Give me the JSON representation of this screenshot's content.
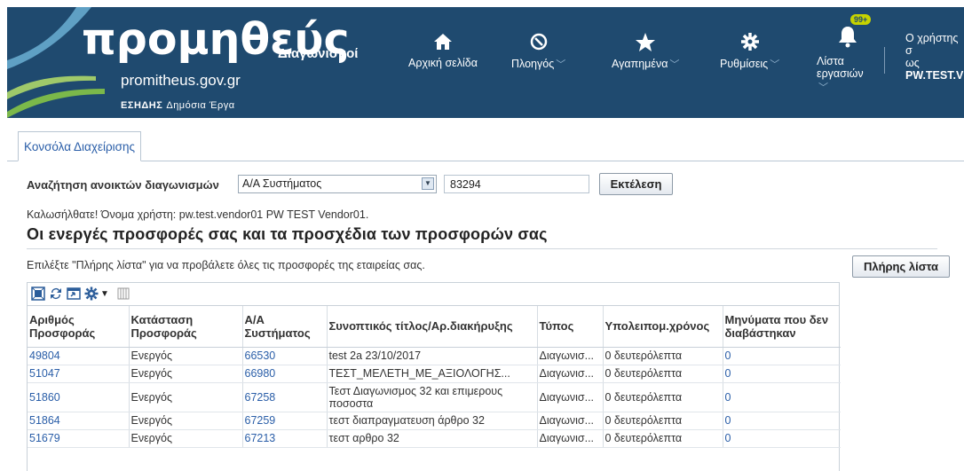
{
  "header": {
    "logo_main": "προμηθεύς",
    "logo_sub": "Διαγωνισμοί",
    "logo_url": "promitheus.gov.gr",
    "logo_org": "ΕΣΗΔΗΣ",
    "logo_org_sub": "Δημόσια Έργα",
    "nav": [
      {
        "label": "Αρχική σελίδα",
        "icon": "home-icon"
      },
      {
        "label": "Πλοηγός",
        "icon": "compass-icon"
      },
      {
        "label": "Αγαπημένα",
        "icon": "star-icon"
      },
      {
        "label": "Ρυθμίσεις",
        "icon": "gear-icon"
      },
      {
        "label": "Λίστα εργασιών",
        "icon": "bell-icon"
      }
    ],
    "notification_count": "99+",
    "user_line1": "Ο χρήστης σ",
    "user_line2": "ως",
    "user_name": "PW.TEST.VI"
  },
  "tabs": [
    "Κονσόλα Διαχείρισης"
  ],
  "search": {
    "label": "Αναζήτηση ανοικτών διαγωνισμών",
    "select_value": "Α/Α Συστήματος",
    "input_value": "83294",
    "button_label": "Εκτέλεση"
  },
  "welcome_text": "Καλωσήλθατε! Όνομα χρήστη: pw.test.vendor01 PW TEST Vendor01.",
  "section_title": "Οι ενεργές προσφορές σας και τα προσχέδια των προσφορών σας",
  "hint_text": "Επιλέξτε \"Πλήρης λίστα\" για να προβάλετε όλες τις προσφορές της εταιρείας σας.",
  "full_list_button": "Πλήρης λίστα",
  "table": {
    "columns": [
      "Αριθμός Προσφοράς",
      "Κατάσταση Προσφοράς",
      "Α/Α Συστήματος",
      "Συνοπτικός τίτλος/Αρ.διακήρυξης",
      "Τύπος",
      "Υπολειπομ.χρόνος",
      "Μηνύματα που δεν διαβάστηκαν"
    ],
    "rows": [
      {
        "offer": "49804",
        "status": "Ενεργός",
        "system_id": "66530",
        "title": "test 2a 23/10/2017",
        "type": "Διαγωνισ...",
        "remaining": "0 δευτερόλεπτα",
        "unread": "0"
      },
      {
        "offer": "51047",
        "status": "Ενεργός",
        "system_id": "66980",
        "title": "ΤΕΣΤ_ΜΕΛΕΤΗ_ΜΕ_ΑΞΙΟΛΟΓΗΣ...",
        "type": "Διαγωνισ...",
        "remaining": "0 δευτερόλεπτα",
        "unread": "0"
      },
      {
        "offer": "51860",
        "status": "Ενεργός",
        "system_id": "67258",
        "title": "Τεστ Διαγωνισμος 32 και επιμερους ποσοστα",
        "type": "Διαγωνισ...",
        "remaining": "0 δευτερόλεπτα",
        "unread": "0"
      },
      {
        "offer": "51864",
        "status": "Ενεργός",
        "system_id": "67259",
        "title": "τεστ διαπραγματευση άρθρο 32",
        "type": "Διαγωνισ...",
        "remaining": "0 δευτερόλεπτα",
        "unread": "0"
      },
      {
        "offer": "51679",
        "status": "Ενεργός",
        "system_id": "67213",
        "title": "τεστ αρθρο 32",
        "type": "Διαγωνισ...",
        "remaining": "0 δευτερόλεπτα",
        "unread": "0"
      }
    ]
  },
  "colors": {
    "header_bg": "#1f4a6f",
    "link": "#2a5ea8",
    "badge": "#c6d300"
  }
}
